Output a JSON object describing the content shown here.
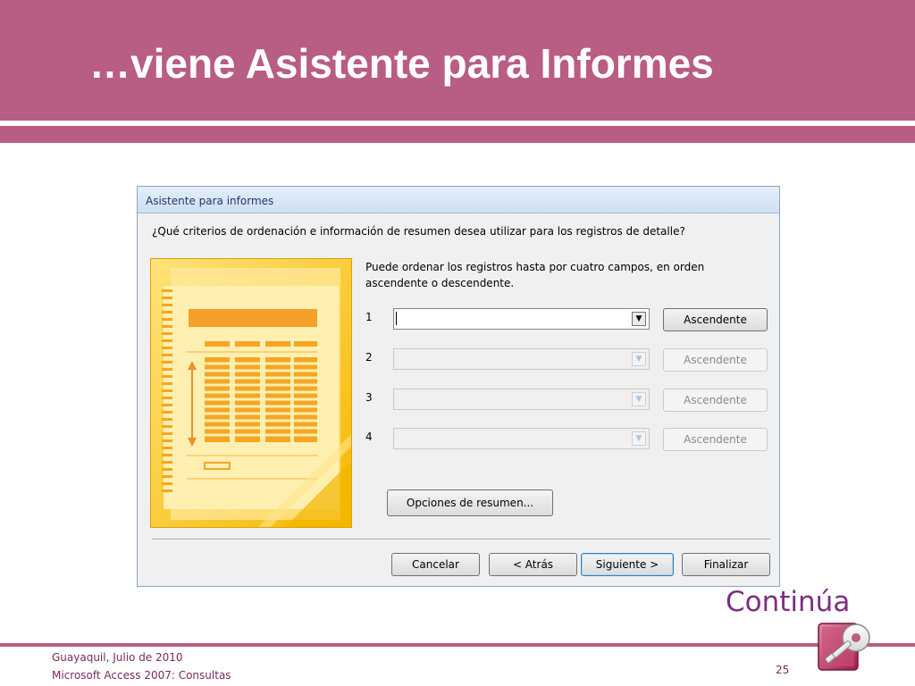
{
  "slide": {
    "title": "…viene Asistente para Informes",
    "continue_label": "Continúa",
    "footer_location": "Guayaquil, Julio de 2010",
    "footer_course": "Microsoft Access 2007: Consultas",
    "page_number": "25"
  },
  "dialog": {
    "title": "Asistente para informes",
    "question": "¿Qué criterios de ordenación e información de resumen desea utilizar para los registros de detalle?",
    "info": "Puede ordenar los registros hasta por cuatro campos, en orden ascendente o descendente.",
    "sort_fields": [
      {
        "number": "1",
        "value": "",
        "order_label": "Ascendente",
        "enabled": true
      },
      {
        "number": "2",
        "value": "",
        "order_label": "Ascendente",
        "enabled": false
      },
      {
        "number": "3",
        "value": "",
        "order_label": "Ascendente",
        "enabled": false
      },
      {
        "number": "4",
        "value": "",
        "order_label": "Ascendente",
        "enabled": false
      }
    ],
    "summary_options_label": "Opciones de resumen...",
    "buttons": {
      "cancel": "Cancelar",
      "back": "< Atrás",
      "next": "Siguiente >",
      "finish": "Finalizar"
    }
  },
  "colors": {
    "banner": "#b85d83",
    "continue_text": "#7b2f80",
    "footer_text": "#7b2a57",
    "illustration": "#ffd040"
  },
  "icons": {
    "logo": "microsoft-access-key-logo",
    "dropdown": "chevron-down-icon"
  }
}
